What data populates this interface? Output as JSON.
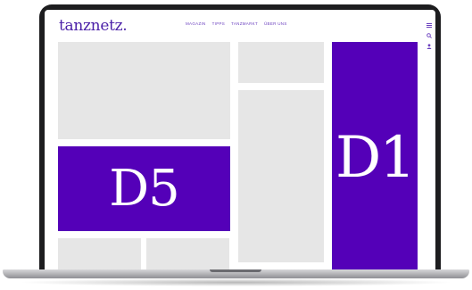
{
  "header": {
    "logo": "tanznetz.",
    "nav": [
      "MAGAZIN",
      "TIPPS",
      "TANZMARKT",
      "ÜBER UNS"
    ],
    "icons": [
      "menu-icon",
      "search-icon",
      "user-icon"
    ]
  },
  "ads": {
    "d1_label": "D1",
    "d5_label": "D5"
  },
  "colors": {
    "brand": "#4a1fa8",
    "ad_purple": "#5400b8",
    "placeholder_grey": "#e6e6e6",
    "laptop_frame": "#1d1d1f"
  }
}
